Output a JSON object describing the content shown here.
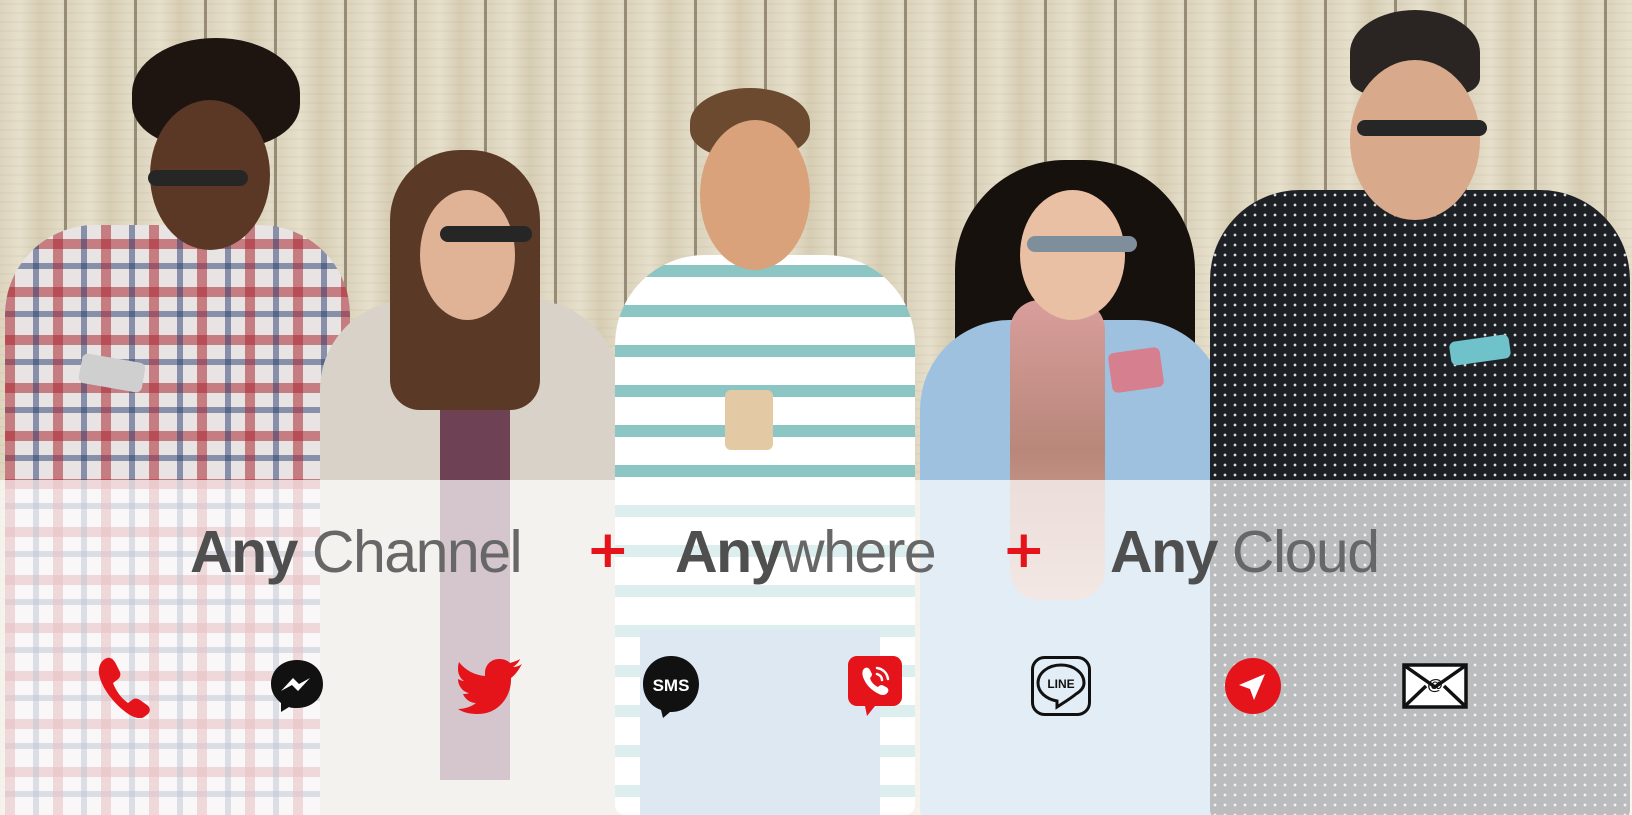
{
  "headline": {
    "part1_strong": "Any",
    "part1_light": " Channel",
    "separator1": "+",
    "part2_strong": "Any",
    "part2_light": "where",
    "separator2": "+",
    "part3_strong": "Any",
    "part3_light": " Cloud"
  },
  "icons": [
    {
      "name": "phone-icon"
    },
    {
      "name": "messenger-icon"
    },
    {
      "name": "twitter-icon"
    },
    {
      "name": "sms-icon",
      "label": "SMS"
    },
    {
      "name": "viber-icon"
    },
    {
      "name": "line-icon",
      "label": "LINE"
    },
    {
      "name": "telegram-icon"
    },
    {
      "name": "email-icon",
      "label": "@"
    }
  ],
  "colors": {
    "accent_red": "#e5141b",
    "text_dark": "#4f4f4f",
    "icon_black": "#111111"
  }
}
